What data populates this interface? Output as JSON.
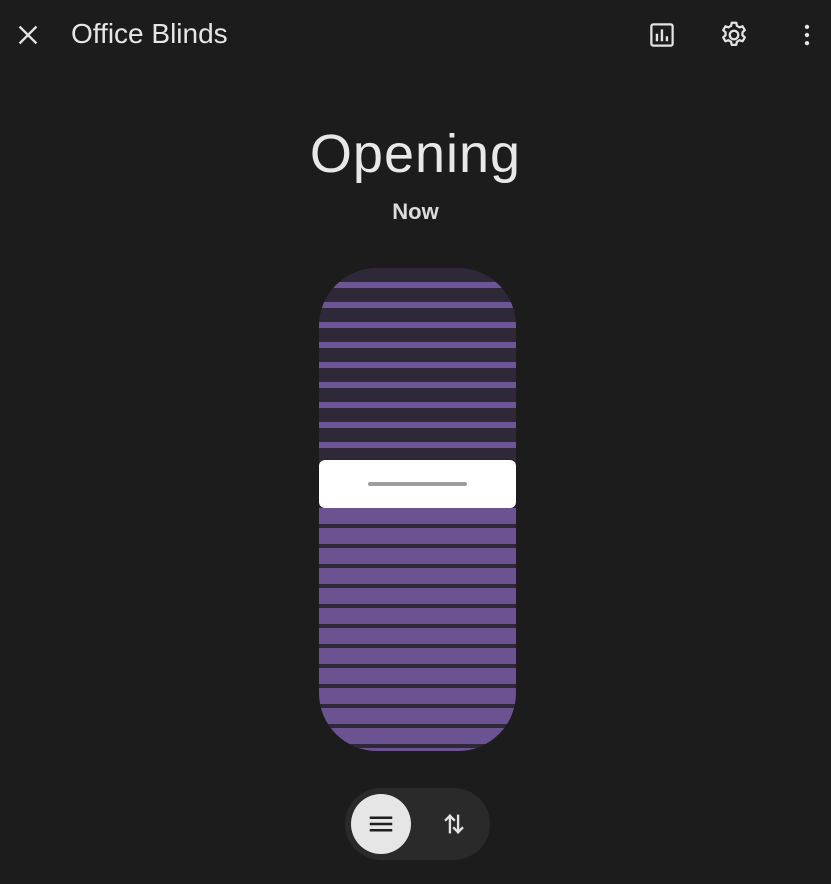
{
  "header": {
    "title": "Office Blinds",
    "close_icon": "close-icon",
    "history_icon": "chart-box-outline-icon",
    "settings_icon": "gear-icon",
    "more_icon": "dots-vertical-icon"
  },
  "status": {
    "state": "Opening",
    "last_changed": "Now"
  },
  "cover": {
    "position_fraction": 0.4,
    "accent_color": "#6d5696"
  },
  "mode_toggle": {
    "options": [
      {
        "name": "position",
        "icon": "menu-icon",
        "selected": true
      },
      {
        "name": "buttons",
        "icon": "swap-vertical-icon",
        "selected": false
      }
    ]
  }
}
